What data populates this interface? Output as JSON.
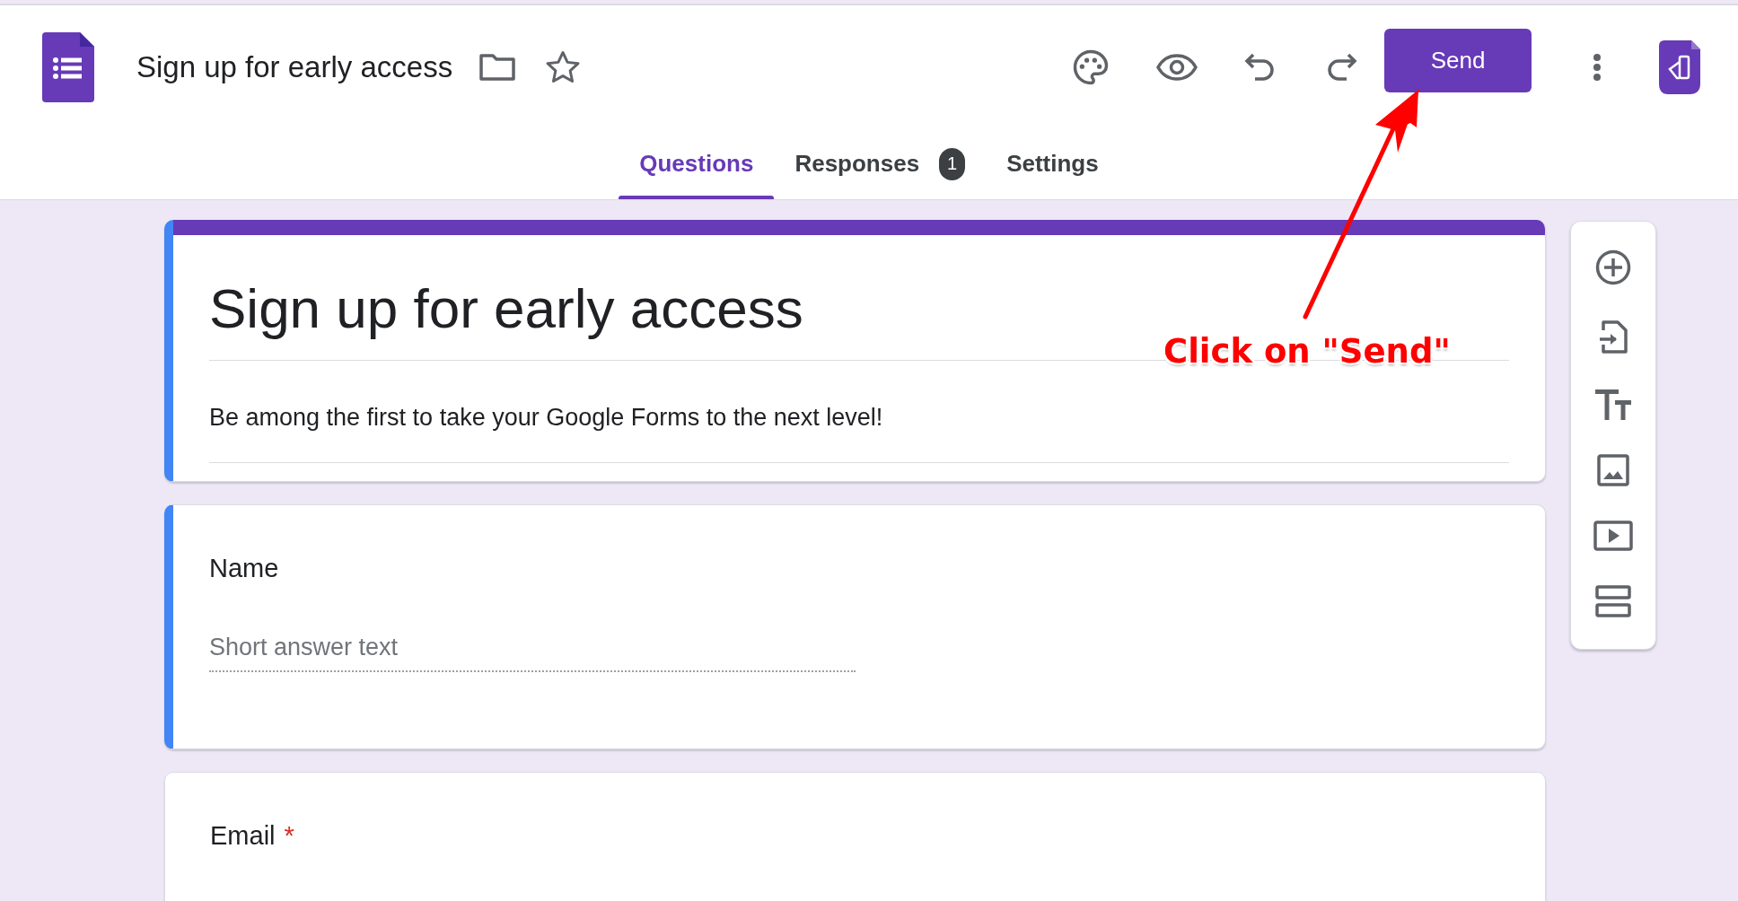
{
  "header": {
    "title": "Sign up for early access",
    "send_button": "Send"
  },
  "tabs": [
    {
      "label": "Questions",
      "selected": true
    },
    {
      "label": "Responses",
      "selected": false,
      "badge": "1"
    },
    {
      "label": "Settings",
      "selected": false
    }
  ],
  "form": {
    "title": "Sign up for early access",
    "description": "Be among the first to take your Google Forms to the next level!",
    "focused": true
  },
  "questions": [
    {
      "label": "Name",
      "placeholder": "Short answer text",
      "focused": true
    },
    {
      "label": "Email",
      "required_mark": "*",
      "focused": false
    }
  ],
  "annotation": {
    "text": "Click on \"Send\""
  }
}
